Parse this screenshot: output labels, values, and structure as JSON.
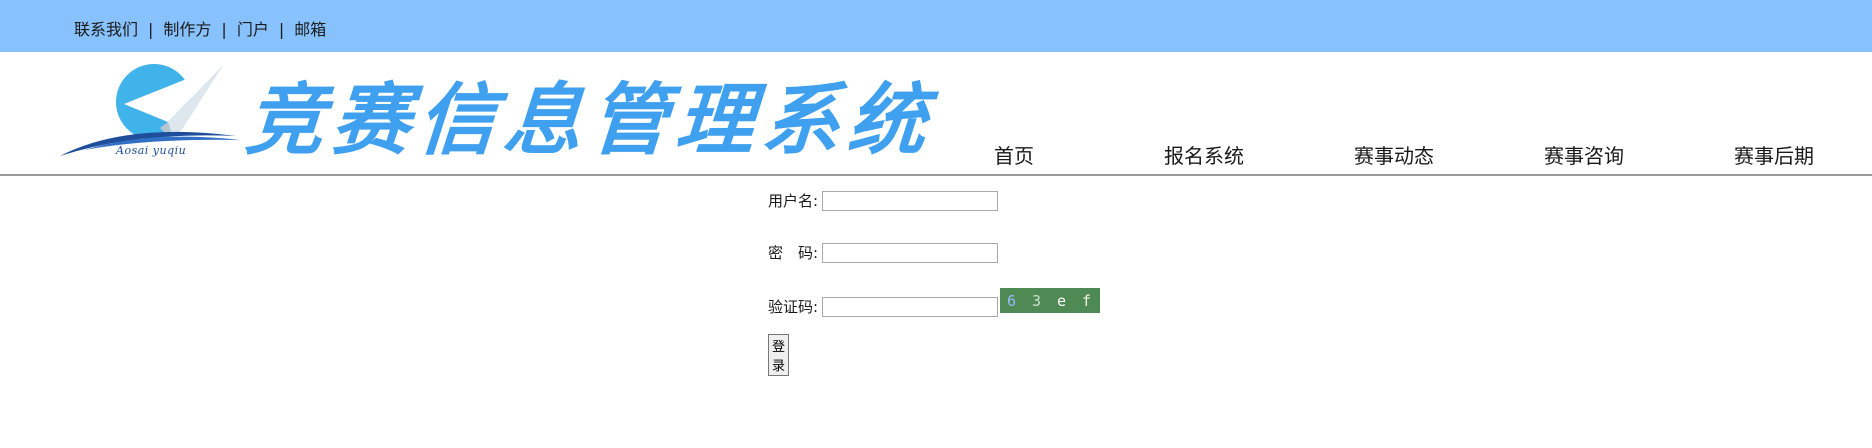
{
  "top_links": {
    "contact": "联系我们",
    "sep": "|",
    "maker": "制作方",
    "portal": "门户",
    "mail": "邮箱"
  },
  "header": {
    "logo_text": "Aosai yuqiu",
    "site_title": "竞赛信息管理系统"
  },
  "nav": {
    "items": [
      "首页",
      "报名系统",
      "赛事动态",
      "赛事咨询",
      "赛事后期"
    ]
  },
  "login": {
    "username_label": "用户名:",
    "username_value": "",
    "password_label": "密　码:",
    "password_value": "",
    "captcha_label": "验证码:",
    "captcha_value": "",
    "captcha_chars": [
      "6",
      "3",
      "e",
      "f"
    ],
    "submit_label": "登录"
  },
  "colors": {
    "topbar": "#87c1fe",
    "title_blue": "#3fa0ef",
    "captcha_bg": "#4f8a55"
  }
}
